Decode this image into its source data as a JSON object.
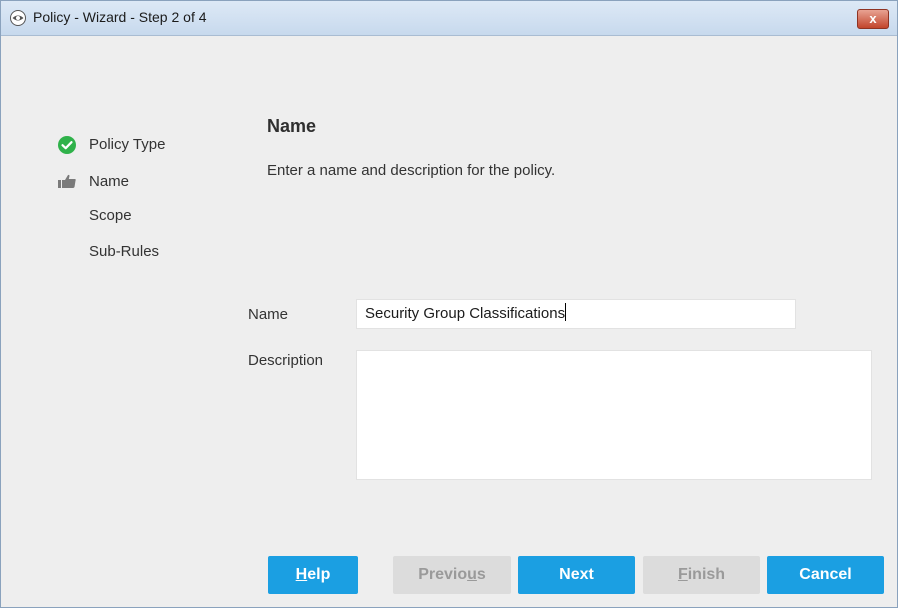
{
  "window": {
    "title": "Policy - Wizard - Step 2 of 4",
    "close_symbol": "x"
  },
  "steps": [
    {
      "label": "Policy Type",
      "icon": "check-circle-icon",
      "state": "completed"
    },
    {
      "label": "Name",
      "icon": "pointing-hand-icon",
      "state": "current"
    },
    {
      "label": "Scope",
      "icon": "",
      "state": "pending"
    },
    {
      "label": "Sub-Rules",
      "icon": "",
      "state": "pending"
    }
  ],
  "page": {
    "heading": "Name",
    "subtitle": "Enter a name and description for the policy."
  },
  "form": {
    "name_label": "Name",
    "name_value": "Security Group Classifications",
    "description_label": "Description",
    "description_value": ""
  },
  "buttons": {
    "help": {
      "pre": "",
      "mnemonic": "H",
      "post": "elp",
      "enabled": true
    },
    "previous": {
      "pre": "Previo",
      "mnemonic": "u",
      "post": "s",
      "enabled": false
    },
    "next": {
      "pre": "Next",
      "mnemonic": "",
      "post": "",
      "enabled": true
    },
    "finish": {
      "pre": "",
      "mnemonic": "F",
      "post": "inish",
      "enabled": false
    },
    "cancel": {
      "pre": "Cancel",
      "mnemonic": "",
      "post": "",
      "enabled": true
    }
  },
  "colors": {
    "primary_button": "#1b9fe2",
    "disabled_button": "#dcdcdc",
    "check_green": "#2fb24a",
    "close_red": "#c2452c"
  }
}
